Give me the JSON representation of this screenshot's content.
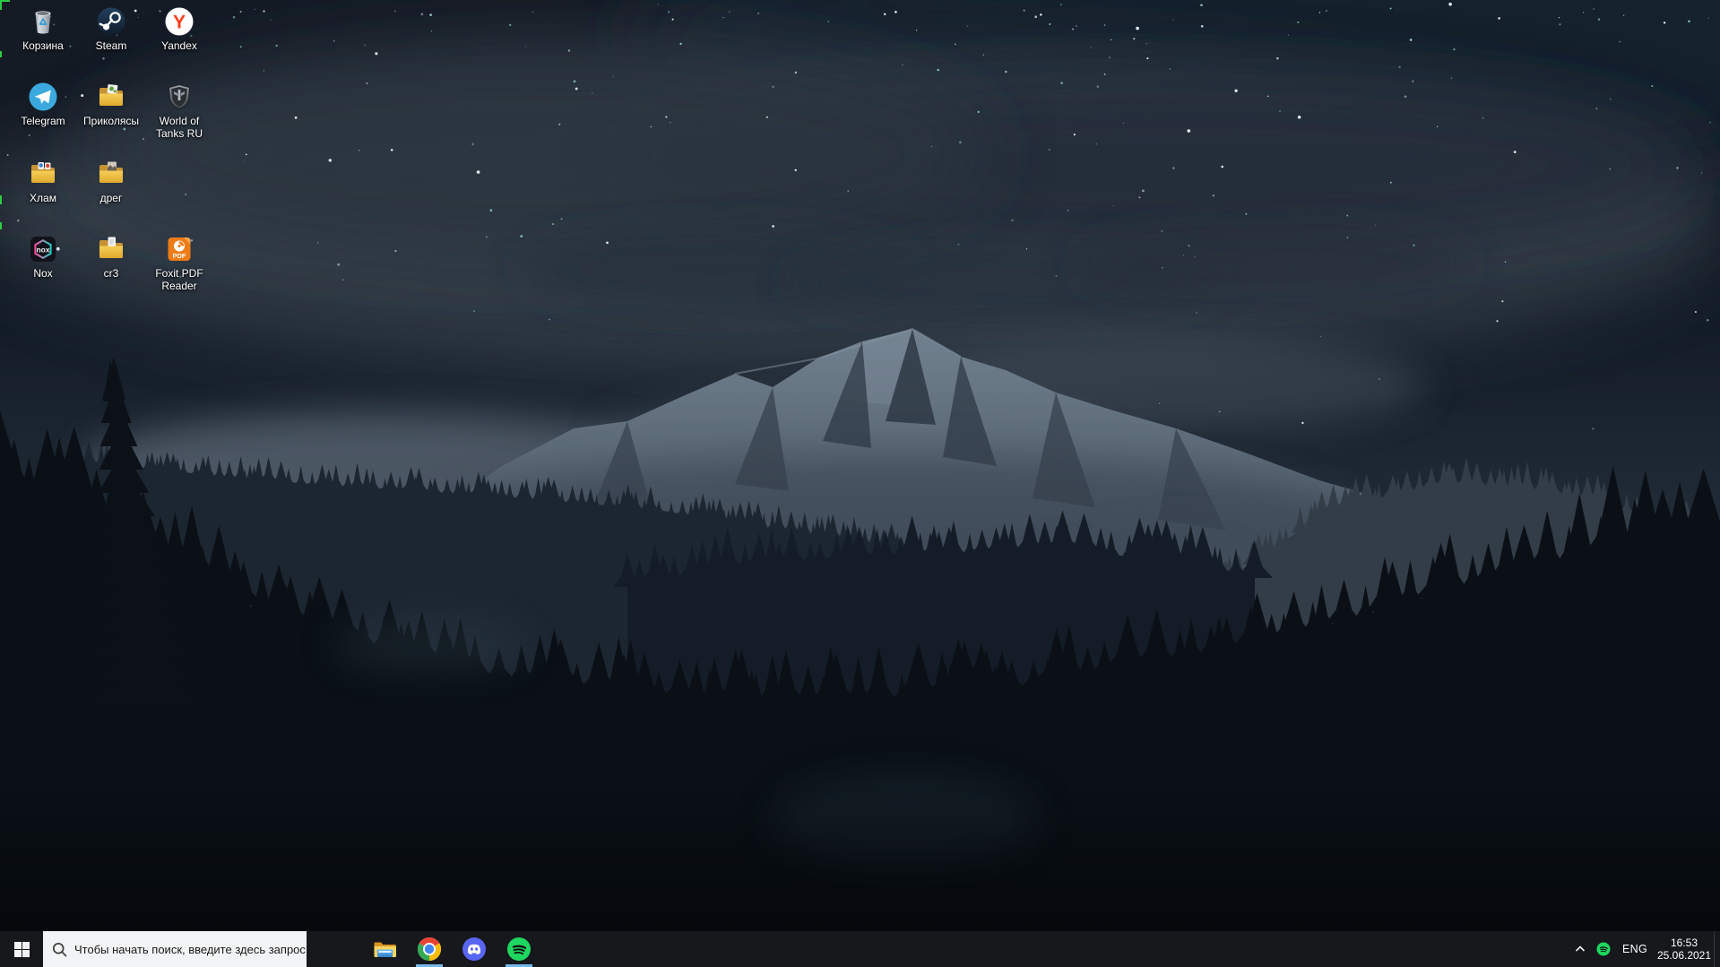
{
  "wallpaper": {
    "name": "night-snowy-mountain-forest",
    "colors": {
      "sky": "#0a0f18",
      "cloud": "#3a4450",
      "snow": "#72818f",
      "forest": "#0a1016"
    }
  },
  "capture_border": {
    "color": "#2ecc40"
  },
  "desktop": {
    "icons": [
      {
        "id": "recycle-bin",
        "label": "Корзина"
      },
      {
        "id": "steam",
        "label": "Steam"
      },
      {
        "id": "yandex",
        "label": "Yandex",
        "icon_text": "Y"
      },
      {
        "id": "telegram",
        "label": "Telegram"
      },
      {
        "id": "prikolyasy",
        "label": "Приколясы",
        "type": "folder"
      },
      {
        "id": "world-of-tanks",
        "label": "World of Tanks RU"
      },
      {
        "id": "khlam",
        "label": "Хлам",
        "type": "folder"
      },
      {
        "id": "dreg",
        "label": "дрег",
        "type": "folder"
      },
      {
        "id": "nox",
        "label": "Nox",
        "icon_text": "nox"
      },
      {
        "id": "cr3",
        "label": "cr3",
        "type": "folder"
      },
      {
        "id": "foxit",
        "label": "Foxit PDF Reader",
        "icon_text": "PDF"
      }
    ]
  },
  "taskbar": {
    "search": {
      "placeholder": "Чтобы начать поиск, введите здесь запрос"
    },
    "apps": [
      {
        "id": "file-explorer",
        "running": false
      },
      {
        "id": "chrome",
        "running": true
      },
      {
        "id": "discord",
        "running": false
      },
      {
        "id": "spotify",
        "running": true
      }
    ],
    "colors": {
      "taskbar_bg": "#16181c",
      "running_indicator": "#77b7e8",
      "search_bg": "#f2f3f4"
    },
    "tray": {
      "language": "ENG",
      "time": "16:53",
      "date": "25.06.2021"
    }
  }
}
